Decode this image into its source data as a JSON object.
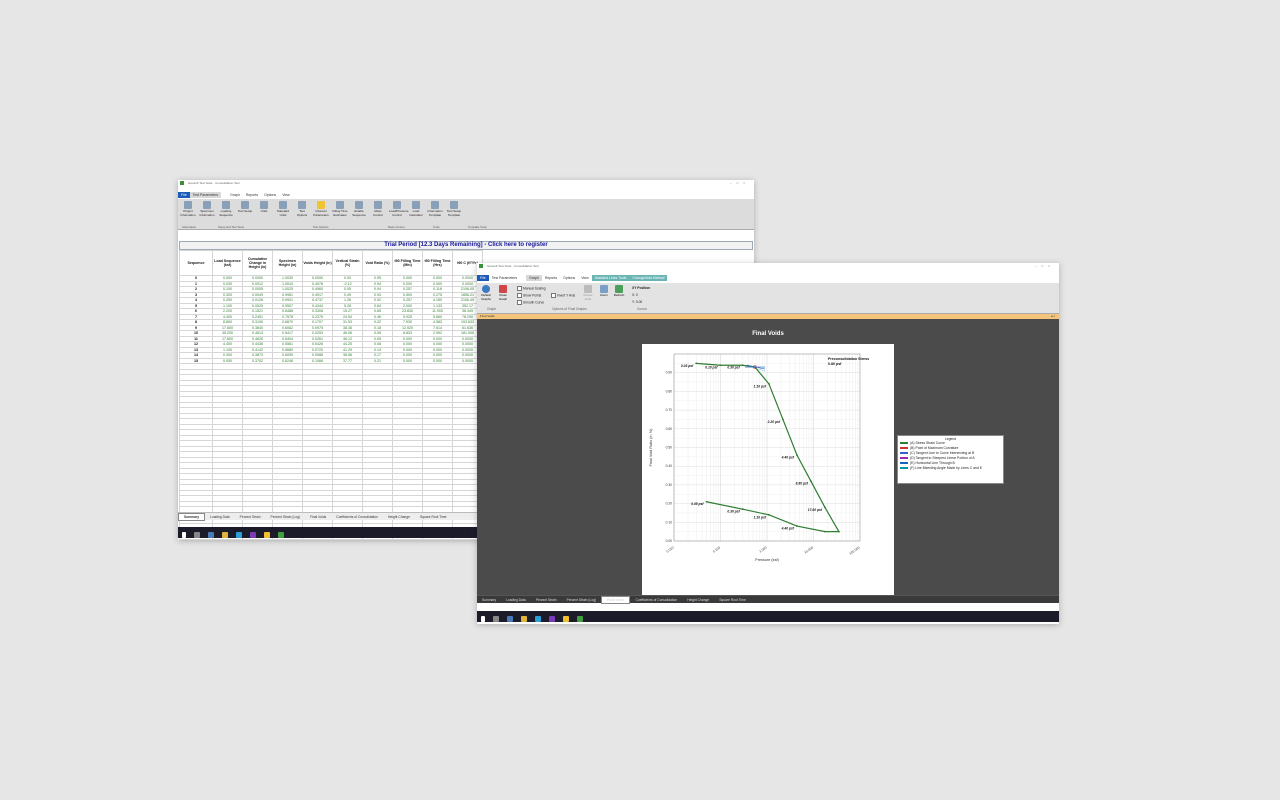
{
  "win1": {
    "title": "Geosoft Test Suite · Consolidation Test",
    "tabs": [
      "File",
      "Test Parameters",
      "",
      "Graph",
      "Reports",
      "Options",
      "View"
    ],
    "active_tab_index": 1,
    "ribbon_buttons": [
      {
        "label": "Project Information",
        "icon": "project-info-icon"
      },
      {
        "label": "Specimen Information",
        "icon": "specimen-info-icon"
      },
      {
        "label": "Loading Sequence",
        "icon": "loading-sequence-icon"
      },
      {
        "label": "Test Setup",
        "icon": "test-setup-icon"
      },
      {
        "label": "Units",
        "icon": "units-icon"
      },
      {
        "label": "Standard Units",
        "icon": "standard-units-icon"
      },
      {
        "label": "Test Options",
        "icon": "test-options-icon"
      },
      {
        "label": "Channel Parameters",
        "icon": "channel-parameters-icon",
        "active": true
      },
      {
        "label": "Filling Time Estimates",
        "icon": "filling-time-icon"
      },
      {
        "label": "Enable Sequence",
        "icon": "enable-sequence-icon"
      },
      {
        "label": "Mass Control",
        "icon": "mass-control-icon"
      },
      {
        "label": "Load/Pressure Control",
        "icon": "load-pressure-control-icon"
      },
      {
        "label": "Load Calculator",
        "icon": "load-calculator-icon"
      },
      {
        "label": "Information Template",
        "icon": "information-template-icon"
      },
      {
        "label": "Test Setup Template",
        "icon": "test-setup-template-icon"
      }
    ],
    "ribbon_groups": [
      "Information",
      "Setup and Test Tools",
      "Test Options",
      "Mass Control",
      "Tools",
      "Template Tools"
    ],
    "banner": "Trial Period [12.3 Days Remaining] - Click here to register",
    "columns": [
      "Sequence",
      "Load Sequence (ksf)",
      "Cumulative Change in Height (in)",
      "Specimen Height (in)",
      "Voids Height (in)",
      "Vertical Strain (%)",
      "Void Ratio (%)",
      "t50 Filling Time (Min)",
      "t50 Filling Time (Hrs)",
      "t90 C (ft²/Yr)"
    ],
    "rows": [
      [
        "0",
        "0.000",
        "0.0000",
        "1.0030",
        "0.0000",
        "0.00",
        "0.95",
        "0.000",
        "0.000",
        "0.0000"
      ],
      [
        "1",
        "0.030",
        "0.0012",
        "1.0043",
        "0.4978",
        "-0.12",
        "0.94",
        "0.000",
        "0.000",
        "0.0000"
      ],
      [
        "2",
        "0.100",
        "0.0005",
        "1.0025",
        "0.4960",
        "0.05",
        "0.94",
        "0.257",
        "0.116",
        "2106.00"
      ],
      [
        "3",
        "0.300",
        "0.0049",
        "0.9981",
        "0.4917",
        "0.49",
        "0.93",
        "0.500",
        "0.275",
        "1856.21"
      ],
      [
        "4",
        "0.250",
        "0.0126",
        "0.9901",
        "0.4737",
        "1.26",
        "0.92",
        "0.257",
        "4.150",
        "2106.49"
      ],
      [
        "5",
        "1.100",
        "0.0529",
        "0.9507",
        "0.4344",
        "5.28",
        "0.84",
        "2.000",
        "1.133",
        "352.17"
      ],
      [
        "6",
        "2.200",
        "0.1521",
        "0.8488",
        "0.3308",
        "15.27",
        "0.65",
        "23.830",
        "11.905",
        "38.349"
      ],
      [
        "7",
        "4.400",
        "0.2451",
        "0.7578",
        "0.2375",
        "24.54",
        "0.46",
        "9.025",
        "5.660",
        "78.290"
      ],
      [
        "8",
        "8.800",
        "0.3190",
        "0.6870",
        "0.1707",
        "31.53",
        "0.32",
        "7.530",
        "4.583",
        "103.633"
      ],
      [
        "9",
        "17.600",
        "0.3840",
        "0.6062",
        "0.0975",
        "38.36",
        "0.18",
        "12.920",
        "7.614",
        "61.636"
      ],
      [
        "10",
        "35.200",
        "0.4613",
        "0.5417",
        "0.0253",
        "46.06",
        "0.05",
        "8.833",
        "2.992",
        "181.000"
      ],
      [
        "11",
        "17.600",
        "0.4626",
        "0.5404",
        "0.0261",
        "46.12",
        "0.05",
        "0.000",
        "0.000",
        "0.0000"
      ],
      [
        "12",
        "4.400",
        "0.4436",
        "0.5561",
        "0.0426",
        "44.25",
        "0.08",
        "0.000",
        "0.000",
        "0.0000"
      ],
      [
        "13",
        "1.100",
        "0.4142",
        "0.5680",
        "0.0720",
        "41.29",
        "0.14",
        "0.000",
        "0.000",
        "0.0000"
      ],
      [
        "14",
        "0.300",
        "0.3873",
        "0.6059",
        "0.0988",
        "38.56",
        "0.17",
        "0.000",
        "0.000",
        "0.0000"
      ],
      [
        "15",
        "0.050",
        "0.3702",
        "0.6246",
        "0.1066",
        "37.77",
        "0.21",
        "0.000",
        "0.000",
        "0.0000"
      ]
    ],
    "status_tabs": [
      "Summary",
      "Loading Data",
      "Percent Strain",
      "Percent Strain (Log)",
      "Final Voids",
      "Coefficients of Consolidation",
      "Height Change",
      "Square Root Time"
    ],
    "active_status_index": 0
  },
  "win2": {
    "title": "Geosoft Test Suite · Consolidation Test",
    "tabs": [
      "File",
      "Test Parameters",
      "",
      "Graph",
      "Reports",
      "Options",
      "View",
      "Assisted Lines Tools",
      "Change/Add Method"
    ],
    "active_tab_index": 3,
    "ribbon": {
      "default_graphs": "Default Graphs",
      "close_graph": "Close Graph",
      "manual_scaling": "Manual Scaling",
      "show_points": "Show Points",
      "smooth_curve": "Smooth Curve",
      "invert_y_axis": "Invert Y Axis",
      "mouse_grab": "Mouse Grab",
      "zoom": "Zoom",
      "refresh": "Refresh",
      "xy_position": "XY Position",
      "x_readout": "X: 0",
      "y_readout": "Y: 0.00",
      "group_graph": "Graph",
      "group_options": "Options of Final Graphs",
      "group_cursor": "Cursor"
    },
    "section": "Final Voids",
    "status_tabs": [
      "Summary",
      "Loading Data",
      "Percent Strain",
      "Percent Strain (Log)",
      "Final Voids",
      "Coefficients of Consolidation",
      "Height Change",
      "Square Root Time"
    ],
    "active_status_index": 4
  },
  "chart_data": {
    "type": "line",
    "title": "Final Voids",
    "xlabel": "Pressure (ksf)",
    "ylabel": "Final Void Ratio (e, %)",
    "xscale": "log",
    "xlim": [
      0.01,
      100
    ],
    "ylim": [
      0.0,
      1.0
    ],
    "x_ticks": [
      "0.010",
      "0.100",
      "1.000",
      "10.000",
      "100.000"
    ],
    "y_ticks": [
      "0.00",
      "0.10",
      "0.20",
      "0.30",
      "0.40",
      "0.50",
      "0.60",
      "0.70",
      "0.80",
      "0.90"
    ],
    "grid": true,
    "annotation_title": "Preconsolidation Stress",
    "annotation_value": "0.80 psf",
    "series": [
      {
        "name": "(A) Stress Strain Curve",
        "color": "#2f7d32",
        "x": [
          0.03,
          0.1,
          0.3,
          0.55,
          1.1,
          2.2,
          4.4,
          8.8,
          17.6,
          35.2,
          17.6,
          4.4,
          1.1,
          0.3,
          0.05
        ],
        "y": [
          0.95,
          0.94,
          0.94,
          0.93,
          0.84,
          0.65,
          0.46,
          0.32,
          0.18,
          0.05,
          0.05,
          0.08,
          0.14,
          0.17,
          0.21
        ]
      }
    ],
    "point_labels": [
      "0.03 psf",
      "0.10 psf",
      "0.30 psf",
      "1.10 psf",
      "2.20 psf",
      "4.40 psf",
      "8.80 psf",
      "17.60 psf",
      "0.05 psf",
      "0.30 psf",
      "1.10 psf",
      "4.40 psf"
    ],
    "legend_title": "Legend",
    "legend": [
      {
        "label": "(A) Stress Strain Curve",
        "color": "#2f7d32"
      },
      {
        "label": "(B) Point of Maximum Curvature",
        "color": "#cc3333"
      },
      {
        "label": "(C) Tangent Line to Curve Intersecting at B",
        "color": "#3a5fcd"
      },
      {
        "label": "(D) Tangent to Steepest Linear Portion of A",
        "color": "#9c27b0"
      },
      {
        "label": "(E) Horizontal Line Through B",
        "color": "#1565c0"
      },
      {
        "label": "(F) Line Bisecting Angle Made by Lines C and E",
        "color": "#0097a7"
      }
    ]
  }
}
